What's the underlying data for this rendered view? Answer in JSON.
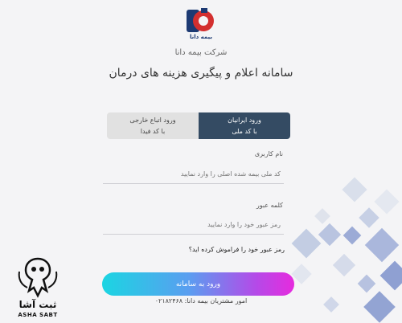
{
  "brand": {
    "logo_text": "بیمه دانا"
  },
  "company_name": "شرکت بیمه دانا",
  "page_title": "سامانه اعلام و پیگیری هزینه های درمان",
  "tabs": [
    {
      "line1": "ورود ایرانیان",
      "line2": "با کد ملی",
      "active": true
    },
    {
      "line1": "ورود اتباع خارجی",
      "line2": "با کد فیدا",
      "active": false
    }
  ],
  "form": {
    "username_label": "نام کاربری",
    "username_placeholder": "کد ملی بیمه شده اصلی را وارد نمایید",
    "password_label": "کلمه عبور",
    "password_placeholder": "رمز عبور خود را وارد نمایید",
    "forgot_link": "رمز عبور خود را فراموش کرده اید؟",
    "submit_label": "ورود به سامانه"
  },
  "support_text": "امور مشتریان بیمه دانا: ۰۲۱۸۲۴۶۸",
  "watermark": {
    "text_fa": "ثبت آشا",
    "text_en": "ASHA SABT"
  },
  "colors": {
    "active_tab": "#344b63",
    "inactive_tab": "#e1e1e1",
    "background": "#f4f4f6",
    "brand_red": "#d32f2f",
    "brand_blue": "#1d3a73"
  }
}
